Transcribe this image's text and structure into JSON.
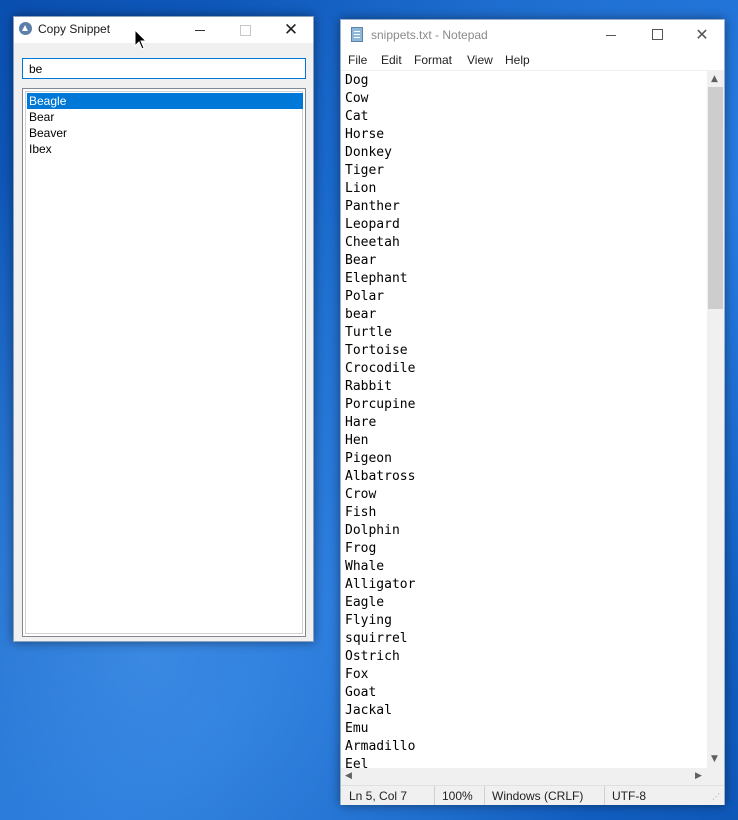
{
  "copy_snippet": {
    "title": "Copy Snippet",
    "search_value": "be",
    "results": [
      "Beagle",
      "Bear",
      "Beaver",
      "Ibex"
    ],
    "selected_index": 0,
    "close_glyph": "✕"
  },
  "notepad": {
    "title": "snippets.txt - Notepad",
    "close_glyph": "✕",
    "menu": [
      "File",
      "Edit",
      "Format",
      "View",
      "Help"
    ],
    "lines": [
      "Dog",
      "Cow",
      "Cat",
      "Horse",
      "Donkey",
      "Tiger",
      "Lion",
      "Panther",
      "Leopard",
      "Cheetah",
      "Bear",
      "Elephant",
      "Polar",
      "bear",
      "Turtle",
      "Tortoise",
      "Crocodile",
      "Rabbit",
      "Porcupine",
      "Hare",
      "Hen",
      "Pigeon",
      "Albatross",
      "Crow",
      "Fish",
      "Dolphin",
      "Frog",
      "Whale",
      "Alligator",
      "Eagle",
      "Flying",
      "squirrel",
      "Ostrich",
      "Fox",
      "Goat",
      "Jackal",
      "Emu",
      "Armadillo",
      "Eel"
    ],
    "status": {
      "position": "Ln 5, Col 7",
      "zoom": "100%",
      "line_ending": "Windows (CRLF)",
      "encoding": "UTF-8"
    },
    "arrows": {
      "up": "▲",
      "down": "▼",
      "left": "◀",
      "right": "▶"
    }
  },
  "colors": {
    "accent": "#0078d7",
    "desktop": "#1565c8"
  },
  "icons": [
    "app-icon",
    "notepad-icon",
    "minimize-icon",
    "maximize-icon",
    "close-icon",
    "mouse-cursor-icon"
  ]
}
